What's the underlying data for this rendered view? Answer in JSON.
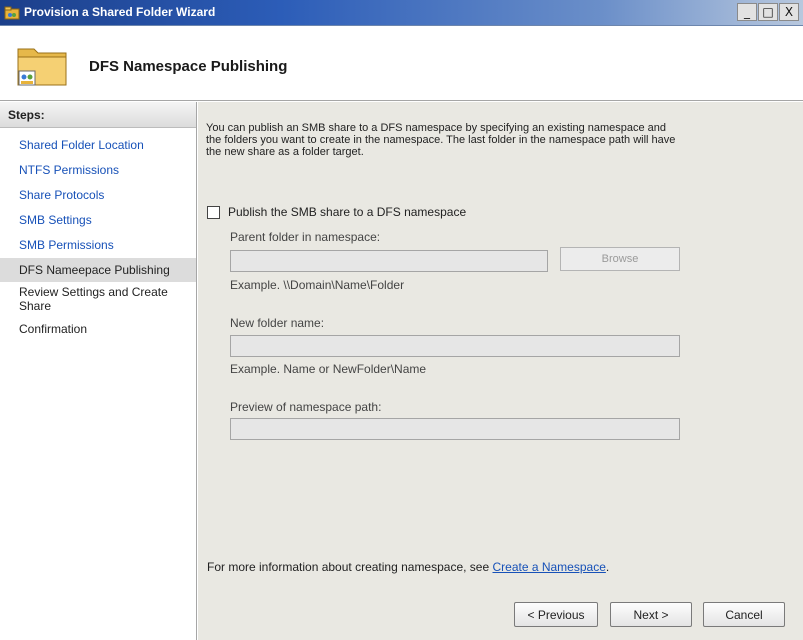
{
  "window": {
    "title": "Provision a Shared Folder Wizard",
    "controls": {
      "minimize": "_",
      "maximize": "□",
      "close": "X"
    }
  },
  "header": {
    "title": "DFS Namespace Publishing",
    "icon": "folder-icon"
  },
  "sidebar": {
    "heading": "Steps:",
    "items": [
      {
        "label": "Shared Folder Location",
        "state": "link"
      },
      {
        "label": "NTFS Permissions",
        "state": "link"
      },
      {
        "label": "Share Protocols",
        "state": "link"
      },
      {
        "label": "SMB Settings",
        "state": "link"
      },
      {
        "label": "SMB Permissions",
        "state": "link"
      },
      {
        "label": "DFS Nameepace Publishing",
        "state": "active"
      },
      {
        "label": "Review Settings and Create Share",
        "state": "plain"
      },
      {
        "label": "Confirmation",
        "state": "plain"
      }
    ]
  },
  "main": {
    "intro": "You can publish an SMB share to a DFS namespace by specifying an existing namespace and the folders you want to create in the namespace. The last folder in the namespace path will have the new share as a folder target.",
    "publish_checkbox": {
      "label": "Publish the SMB share to a DFS namespace",
      "checked": false
    },
    "parent_folder": {
      "label": "Parent folder in namespace:",
      "value": "",
      "example": "Example. \\\\Domain\\Name\\Folder"
    },
    "browse_label": "Browse",
    "new_folder": {
      "label": "New folder name:",
      "value": "",
      "example": "Example. Name or NewFolder\\Name"
    },
    "preview": {
      "label": "Preview of namespace path:",
      "value": ""
    },
    "more_info": {
      "prefix": "For more information about creating namespace, see ",
      "link": "Create a Namespace",
      "suffix": "."
    }
  },
  "footer": {
    "previous": "< Previous",
    "next": "Next >",
    "cancel": "Cancel"
  }
}
